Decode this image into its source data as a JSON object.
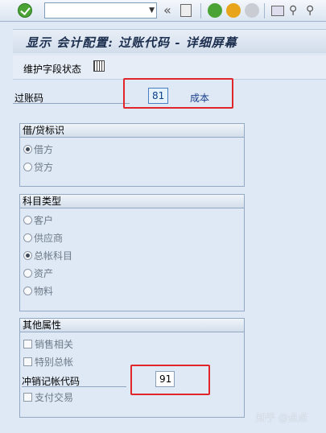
{
  "toolbar": {
    "command_field": "",
    "icons": [
      "enter-icon",
      "command-dropdown-icon",
      "collapse-icon",
      "save-icon",
      "back-icon",
      "exit-icon",
      "cancel-icon",
      "print-icon",
      "find-icon",
      "find-next-icon"
    ]
  },
  "title": "显示 会计配置: 过账代码 - 详细屏幕",
  "app_toolbar": {
    "maintain_field_status": "维护字段状态"
  },
  "posting_key": {
    "label": "过账码",
    "value": "81",
    "description": "成本"
  },
  "debit_credit": {
    "header": "借/贷标识",
    "options": [
      {
        "label": "借方",
        "selected": true
      },
      {
        "label": "贷方",
        "selected": false
      }
    ]
  },
  "account_type": {
    "header": "科目类型",
    "options": [
      {
        "label": "客户",
        "selected": false
      },
      {
        "label": "供应商",
        "selected": false
      },
      {
        "label": "总帐科目",
        "selected": true
      },
      {
        "label": "资产",
        "selected": false
      },
      {
        "label": "物料",
        "selected": false
      }
    ]
  },
  "other_attributes": {
    "header": "其他属性",
    "sales_related": "销售相关",
    "special_gl": "特别总帐",
    "reversal_key_label": "冲销记帐代码",
    "reversal_key_value": "91",
    "payment_transaction": "支付交易"
  },
  "watermark": "知乎 @点点",
  "colors": {
    "highlight": "#e0262b",
    "link": "#1a3e8c",
    "background": "#dfe9f5"
  }
}
